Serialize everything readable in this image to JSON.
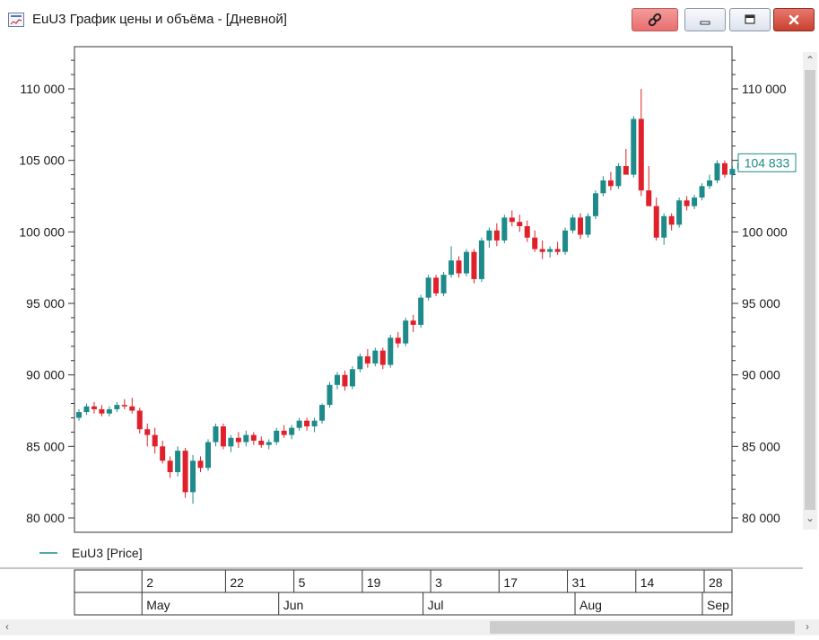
{
  "window": {
    "title": "EuU3 График цены и объёма - [Дневной]",
    "buttons": {
      "link": "link-icon",
      "minimize": "minimize-icon",
      "maximize": "maximize-icon",
      "close": "close-icon"
    }
  },
  "legend": {
    "label": "EuU3 [Price]"
  },
  "chart_data": {
    "type": "candlestick",
    "ylim": [
      79000,
      113000
    ],
    "y_ticks": [
      "80 000",
      "85 000",
      "90 000",
      "95 000",
      "100 000",
      "105 000",
      "110 000"
    ],
    "y_tick_values": [
      80000,
      85000,
      90000,
      95000,
      100000,
      105000,
      110000
    ],
    "last_price_label": "104 833",
    "last_price": 104833,
    "grid": false,
    "colors": {
      "up": "#1f8a8a",
      "down": "#e0202a"
    },
    "x_day_labels": [
      {
        "label": "2",
        "index": 9
      },
      {
        "label": "22",
        "index": 20
      },
      {
        "label": "5",
        "index": 29
      },
      {
        "label": "19",
        "index": 38
      },
      {
        "label": "3",
        "index": 47
      },
      {
        "label": "17",
        "index": 56
      },
      {
        "label": "31",
        "index": 65
      },
      {
        "label": "14",
        "index": 74
      },
      {
        "label": "28",
        "index": 83
      }
    ],
    "x_month_labels": [
      {
        "label": "May",
        "index": 9
      },
      {
        "label": "Jun",
        "index": 27
      },
      {
        "label": "Jul",
        "index": 46
      },
      {
        "label": "Aug",
        "index": 66
      },
      {
        "label": "Sep",
        "index": 87
      }
    ],
    "series": [
      {
        "name": "EuU3 [Price]",
        "candles": [
          [
            87000,
            87600,
            86800,
            87400
          ],
          [
            87400,
            88000,
            87200,
            87800
          ],
          [
            87800,
            88100,
            87300,
            87600
          ],
          [
            87600,
            87900,
            87100,
            87300
          ],
          [
            87300,
            87800,
            87100,
            87600
          ],
          [
            87600,
            88100,
            87400,
            87900
          ],
          [
            87900,
            88300,
            87600,
            87800
          ],
          [
            87800,
            88400,
            87300,
            87500
          ],
          [
            87500,
            87700,
            85900,
            86200
          ],
          [
            86200,
            86600,
            85000,
            85800
          ],
          [
            85800,
            86300,
            84500,
            85000
          ],
          [
            85000,
            85400,
            83800,
            84000
          ],
          [
            84000,
            84300,
            82800,
            83200
          ],
          [
            83200,
            85000,
            82900,
            84700
          ],
          [
            84700,
            84900,
            81400,
            81800
          ],
          [
            81800,
            84400,
            81000,
            84000
          ],
          [
            84000,
            84300,
            83200,
            83500
          ],
          [
            83500,
            85500,
            83300,
            85300
          ],
          [
            85300,
            86600,
            85000,
            86400
          ],
          [
            86400,
            86600,
            84800,
            85000
          ],
          [
            85000,
            85800,
            84600,
            85600
          ],
          [
            85600,
            86000,
            84900,
            85300
          ],
          [
            85300,
            86100,
            85000,
            85800
          ],
          [
            85800,
            86000,
            85100,
            85400
          ],
          [
            85400,
            85700,
            84900,
            85100
          ],
          [
            85100,
            85500,
            84800,
            85300
          ],
          [
            85300,
            86300,
            85100,
            86100
          ],
          [
            86100,
            86500,
            85600,
            85800
          ],
          [
            85800,
            86500,
            85500,
            86300
          ],
          [
            86300,
            87000,
            86100,
            86800
          ],
          [
            86800,
            87000,
            86100,
            86400
          ],
          [
            86400,
            87000,
            86000,
            86800
          ],
          [
            86800,
            88000,
            86600,
            87900
          ],
          [
            87900,
            89500,
            87700,
            89300
          ],
          [
            89300,
            90200,
            89000,
            90000
          ],
          [
            90000,
            90300,
            88900,
            89200
          ],
          [
            89200,
            90600,
            89000,
            90400
          ],
          [
            90400,
            91500,
            90200,
            91300
          ],
          [
            91300,
            91800,
            90500,
            90800
          ],
          [
            90800,
            91900,
            90600,
            91700
          ],
          [
            91700,
            91900,
            90400,
            90700
          ],
          [
            90700,
            92800,
            90500,
            92600
          ],
          [
            92600,
            93000,
            91900,
            92200
          ],
          [
            92200,
            94000,
            92000,
            93800
          ],
          [
            93800,
            94200,
            93000,
            93500
          ],
          [
            93500,
            95600,
            93300,
            95400
          ],
          [
            95400,
            97000,
            95200,
            96800
          ],
          [
            96800,
            97000,
            95500,
            95700
          ],
          [
            95700,
            97200,
            95500,
            97000
          ],
          [
            97000,
            99000,
            96800,
            98000
          ],
          [
            98000,
            98300,
            96800,
            97100
          ],
          [
            97100,
            98800,
            96900,
            98600
          ],
          [
            98600,
            98800,
            96400,
            96700
          ],
          [
            96700,
            99600,
            96500,
            99400
          ],
          [
            99400,
            100300,
            98900,
            100100
          ],
          [
            100100,
            100600,
            99000,
            99400
          ],
          [
            99400,
            101200,
            99200,
            101000
          ],
          [
            101000,
            101500,
            100400,
            100700
          ],
          [
            100700,
            101200,
            100000,
            100400
          ],
          [
            100400,
            100800,
            99300,
            99600
          ],
          [
            99600,
            100100,
            98600,
            98800
          ],
          [
            98800,
            99400,
            98100,
            98600
          ],
          [
            98600,
            99000,
            98200,
            98800
          ],
          [
            98800,
            99300,
            98400,
            98600
          ],
          [
            98600,
            100300,
            98400,
            100100
          ],
          [
            100100,
            101200,
            99900,
            101000
          ],
          [
            101000,
            101300,
            99500,
            99800
          ],
          [
            99800,
            101300,
            99600,
            101100
          ],
          [
            101100,
            102900,
            100900,
            102700
          ],
          [
            102700,
            103900,
            102500,
            103600
          ],
          [
            103600,
            104200,
            102900,
            103200
          ],
          [
            103200,
            104800,
            103000,
            104600
          ],
          [
            104600,
            105800,
            104300,
            104000
          ],
          [
            104000,
            108100,
            103800,
            107900
          ],
          [
            107900,
            110000,
            102500,
            102900
          ],
          [
            102900,
            104600,
            102400,
            101800
          ],
          [
            101800,
            102400,
            99400,
            99600
          ],
          [
            99600,
            101300,
            99100,
            101100
          ],
          [
            101100,
            101300,
            100100,
            100500
          ],
          [
            100500,
            102400,
            100300,
            102200
          ],
          [
            102200,
            102500,
            101500,
            101800
          ],
          [
            101800,
            102600,
            101600,
            102400
          ],
          [
            102400,
            103400,
            102200,
            103200
          ],
          [
            103200,
            104000,
            103000,
            103600
          ],
          [
            103600,
            105000,
            103400,
            104800
          ],
          [
            104800,
            105000,
            103800,
            104000
          ],
          [
            104000,
            104600,
            103800,
            104400
          ],
          [
            104400,
            104900,
            104200,
            104800
          ]
        ]
      }
    ]
  }
}
